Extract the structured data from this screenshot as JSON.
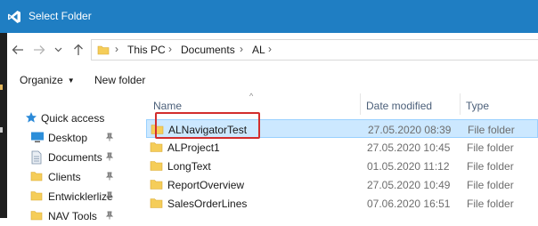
{
  "window": {
    "title": "Select Folder",
    "title_icon": "vscode-icon",
    "colors": {
      "titlebar": "#1f7ec3",
      "selection": "#cce8ff",
      "selection_border": "#99d1ff",
      "annotation": "#d22d2d"
    }
  },
  "address": {
    "crumbs": [
      "This PC",
      "Documents",
      "AL"
    ],
    "icons": [
      "back-arrow-icon",
      "forward-arrow-icon",
      "chevron-down-icon",
      "up-arrow-icon",
      "folder-icon",
      "chevron-right-icon"
    ]
  },
  "toolbar": {
    "organize_label": "Organize",
    "new_folder_label": "New folder"
  },
  "navigation": {
    "items": [
      {
        "label": "Quick access",
        "icon": "star-icon",
        "pinned": false
      },
      {
        "label": "Desktop",
        "icon": "desktop-icon",
        "pinned": true
      },
      {
        "label": "Documents",
        "icon": "documents-icon",
        "pinned": true
      },
      {
        "label": "Clients",
        "icon": "folder-icon",
        "pinned": true
      },
      {
        "label": "Entwicklerlize",
        "icon": "folder-icon",
        "pinned": true
      },
      {
        "label": "NAV Tools",
        "icon": "folder-icon",
        "pinned": true
      }
    ]
  },
  "filelist": {
    "columns": {
      "name": "Name",
      "date": "Date modified",
      "type": "Type"
    },
    "rows": [
      {
        "name": "ALNavigatorTest",
        "date": "27.05.2020 08:39",
        "type": "File folder",
        "selected": true
      },
      {
        "name": "ALProject1",
        "date": "27.05.2020 10:45",
        "type": "File folder",
        "selected": false
      },
      {
        "name": "LongText",
        "date": "01.05.2020 11:12",
        "type": "File folder",
        "selected": false
      },
      {
        "name": "ReportOverview",
        "date": "27.05.2020 10:49",
        "type": "File folder",
        "selected": false
      },
      {
        "name": "SalesOrderLines",
        "date": "07.06.2020 16:51",
        "type": "File folder",
        "selected": false
      }
    ]
  }
}
